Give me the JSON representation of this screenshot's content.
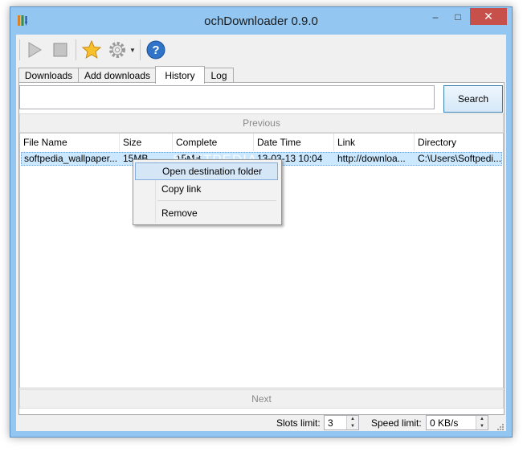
{
  "window": {
    "title": "ochDownloader 0.9.0",
    "controls": {
      "minimize": "–",
      "maximize": "□",
      "close": "✕"
    }
  },
  "toolbar": {
    "icons": [
      "play-icon",
      "stop-icon",
      "star-icon",
      "gear-icon",
      "chevron-down-icon",
      "help-icon"
    ],
    "help_glyph": "?"
  },
  "tabs": [
    {
      "label": "Downloads",
      "active": false
    },
    {
      "label": "Add downloads",
      "active": false
    },
    {
      "label": "History",
      "active": true
    },
    {
      "label": "Log",
      "active": false
    }
  ],
  "search": {
    "value": "",
    "button_label": "Search"
  },
  "nav": {
    "previous": "Previous",
    "next": "Next"
  },
  "table": {
    "columns": [
      "File Name",
      "Size",
      "Complete",
      "Date Time",
      "Link",
      "Directory"
    ],
    "rows": [
      {
        "file_name": "softpedia_wallpaper...",
        "size": "15MB",
        "complete": "15MB",
        "date_time": "13-03-13 10:04",
        "link": "http://downloa...",
        "directory": "C:\\Users\\Softpedi..."
      }
    ]
  },
  "watermark": "SOFTPEDIA",
  "context_menu": {
    "items": [
      "Open destination folder",
      "Copy link",
      "Remove"
    ]
  },
  "statusbar": {
    "slots_label": "Slots limit:",
    "slots_value": "3",
    "speed_label": "Speed limit:",
    "speed_value": "0 KB/s"
  },
  "colors": {
    "frame": "#93c7f1",
    "close_button": "#c7504a",
    "selection": "#cce8ff",
    "menu_hover": "#d5e6f7"
  }
}
